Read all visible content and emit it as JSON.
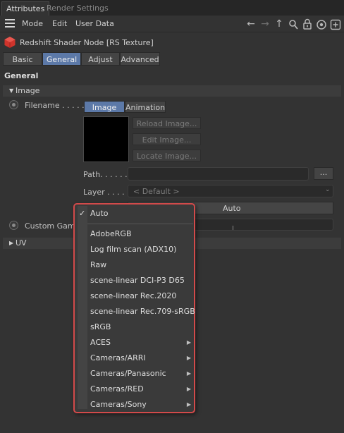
{
  "tabs": {
    "attributes": "Attributes",
    "render_settings": "Render Settings"
  },
  "menu": {
    "mode": "Mode",
    "edit": "Edit",
    "user_data": "User Data"
  },
  "node": {
    "title": "Redshift Shader Node [RS Texture]"
  },
  "subtabs": {
    "basic": "Basic",
    "general": "General",
    "adjust": "Adjust",
    "advanced": "Advanced"
  },
  "section": {
    "general": "General",
    "image": "Image",
    "uv": "UV"
  },
  "filename": {
    "label": "Filename . . . . .",
    "tab_image": "Image",
    "tab_animation": "Animation",
    "reload": "Reload Image...",
    "edit": "Edit Image...",
    "locate": "Locate Image..."
  },
  "path": {
    "label": "Path. . . . . .",
    "value": "",
    "browse": "..."
  },
  "layer": {
    "label": "Layer . . . . .",
    "value": "< Default >"
  },
  "color_space": {
    "value": "Auto"
  },
  "custom_gamma": {
    "label": "Custom Gamm"
  },
  "dropdown": {
    "selected": "Auto",
    "items": [
      {
        "label": "AdobeRGB",
        "submenu": false
      },
      {
        "label": "Log film scan (ADX10)",
        "submenu": false
      },
      {
        "label": "Raw",
        "submenu": false
      },
      {
        "label": "scene-linear DCI-P3 D65",
        "submenu": false
      },
      {
        "label": "scene-linear Rec.2020",
        "submenu": false
      },
      {
        "label": "scene-linear Rec.709-sRGB",
        "submenu": false
      },
      {
        "label": "sRGB",
        "submenu": false
      },
      {
        "label": "ACES",
        "submenu": true
      },
      {
        "label": "Cameras/ARRI",
        "submenu": true
      },
      {
        "label": "Cameras/Panasonic",
        "submenu": true
      },
      {
        "label": "Cameras/RED",
        "submenu": true
      },
      {
        "label": "Cameras/Sony",
        "submenu": true
      }
    ]
  },
  "colors": {
    "accent": "#5c79a8",
    "highlight_border": "#d24a4a",
    "node_icon": "#d0342c"
  }
}
